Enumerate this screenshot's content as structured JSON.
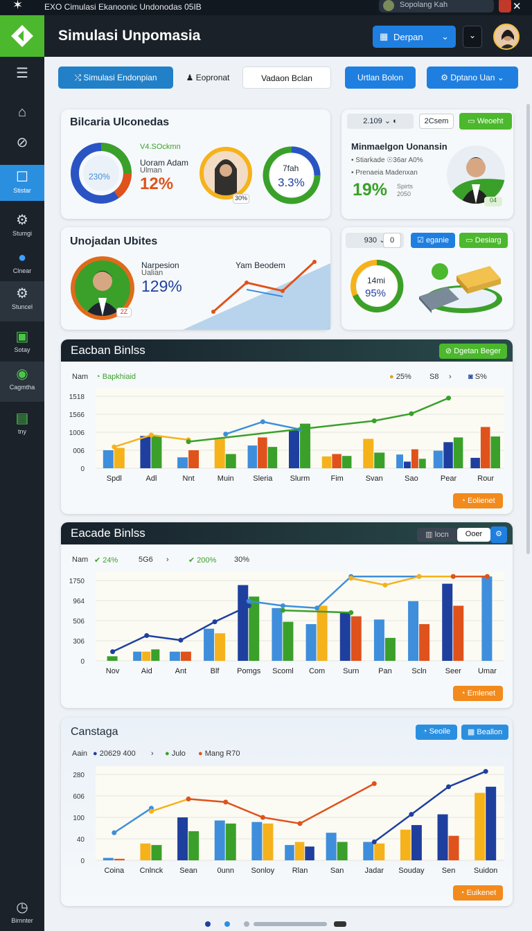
{
  "topbar": {
    "title": "EXO Cimulasi Ekanoonic Undonodas 05IB",
    "search_text": "Sopolang Kah",
    "close_glyph": "✕"
  },
  "header": {
    "title": "Simulasi Unpomasia",
    "dropdown_label": "Derpan"
  },
  "sidebar": {
    "items": [
      {
        "label": ""
      },
      {
        "label": ""
      },
      {
        "label": ""
      },
      {
        "label": "Stistar"
      },
      {
        "label": "Stumgi"
      },
      {
        "label": "Clnear"
      },
      {
        "label": "Stuncel"
      },
      {
        "label": "Sotay"
      },
      {
        "label": "Cagmtha"
      },
      {
        "label": "tny"
      },
      {
        "label": "Birnnter"
      }
    ]
  },
  "tabs": {
    "t1": "Simulasi Endonpian",
    "t2": "Eopronat",
    "t3": "Vadaon Bclan",
    "t4": "Urtlan Bolon",
    "t5": "Dptano Uan"
  },
  "card1": {
    "title": "Bilcaria Ulconedas",
    "ring_pct": "230%",
    "tag": "V4.SOckmn",
    "sub1": "Uoram Adam",
    "sub2": "Ulman",
    "big": "12%",
    "badge": "30%",
    "ring3_top": "7fah",
    "ring3_val": "3.3%"
  },
  "card2": {
    "title": "Minmaelgon Uonansin",
    "sel1": "2.109",
    "sel2": "2Csem",
    "btn": "Weoeht",
    "line1": "• Stiarkade ☉36ar A0%",
    "line2": "• Prenaeia Madenxan",
    "big": "19%",
    "small1": "Spirts",
    "small2": "2050",
    "badge": "04"
  },
  "card3": {
    "title": "Unojadan Ubites",
    "sub1": "Narpesion",
    "sub2": "Ualian",
    "big": "129%",
    "right_label": "Yam Beodem",
    "badge": "2Z"
  },
  "card4": {
    "sel1": "930",
    "sel2": "0",
    "btn1": "eganie",
    "btn2": "Desiarg",
    "ring_top": "14mi",
    "ring_val": "95%"
  },
  "sec1": {
    "title": "Eacban Binlss",
    "head_btn": "Dgetan Beger",
    "leg_name": "Nam",
    "leg1": "Bapkhiaid",
    "leg2": "25%",
    "leg3": "S8",
    "leg4": "S%",
    "btn": "Eolienet"
  },
  "sec2": {
    "title": "Eacade Binlss",
    "seg1": "locn",
    "seg2": "Ooer",
    "leg_name": "Nam",
    "leg1": "24%",
    "leg2": "5G6",
    "leg3": "200%",
    "leg4": "30%",
    "btn": "Emlenet"
  },
  "sec3": {
    "title": "Canstaga",
    "btn1": "Seoile",
    "btn2": "Beallon",
    "leg_name": "Aain",
    "leg1": "20629 400",
    "leg2": "Julo",
    "leg3": "Mang R70",
    "btn": "Euikenet"
  },
  "chart_data": [
    {
      "type": "bar",
      "title": "Eacban Binlss",
      "categories": [
        "Spdl",
        "Adl",
        "Nnt",
        "Muin",
        "Sleria",
        "Slurm",
        "Fim",
        "Svan",
        "Sao",
        "Pear",
        "Rour"
      ],
      "yticks": [
        "0",
        "006",
        "1006",
        "1566",
        "1518"
      ],
      "ylim": [
        0,
        1518
      ],
      "series": [
        {
          "color": "#3e8edc",
          "values": [
            380,
            0,
            230,
            0,
            480,
            0,
            0,
            0,
            290,
            370,
            0
          ]
        },
        {
          "color": "#f5b21b",
          "values": [
            430,
            0,
            0,
            630,
            0,
            0,
            250,
            620,
            0,
            0,
            0
          ]
        },
        {
          "color": "#1f3f9f",
          "values": [
            0,
            680,
            0,
            0,
            0,
            800,
            0,
            0,
            140,
            550,
            220
          ]
        },
        {
          "color": "#e0521b",
          "values": [
            0,
            0,
            380,
            0,
            650,
            0,
            300,
            0,
            400,
            0,
            870
          ]
        },
        {
          "color": "#3aa02a",
          "values": [
            0,
            690,
            0,
            300,
            450,
            940,
            260,
            330,
            200,
            650,
            670
          ]
        }
      ],
      "lines": [
        {
          "color": "#f5b21b",
          "values": [
            450,
            700,
            600,
            0,
            0,
            0,
            0,
            0,
            0,
            0,
            0
          ]
        },
        {
          "color": "#3e8edc",
          "values": [
            0,
            0,
            0,
            720,
            980,
            820,
            0,
            0,
            0,
            0,
            0
          ]
        },
        {
          "color": "#3aa02a",
          "values": [
            0,
            0,
            560,
            0,
            0,
            0,
            0,
            1000,
            1150,
            1480,
            0
          ]
        }
      ]
    },
    {
      "type": "bar",
      "title": "Eacade Binlss",
      "categories": [
        "Nov",
        "Aid",
        "Ant",
        "Blf",
        "Pomgs",
        "Scoml",
        "Com",
        "Surn",
        "Pan",
        "Scln",
        "Seer",
        "Umar"
      ],
      "yticks": [
        "0",
        "306",
        "506",
        "964",
        "1750"
      ],
      "ylim": [
        0,
        1750
      ],
      "series": [
        {
          "color": "#3e8edc",
          "values": [
            0,
            200,
            200,
            700,
            0,
            1150,
            800,
            0,
            900,
            1300,
            0,
            1850
          ]
        },
        {
          "color": "#f5b21b",
          "values": [
            0,
            200,
            0,
            600,
            0,
            0,
            1200,
            0,
            0,
            0,
            0,
            0
          ]
        },
        {
          "color": "#1f3f9f",
          "values": [
            0,
            0,
            0,
            0,
            1650,
            0,
            0,
            1050,
            0,
            0,
            1680,
            0
          ]
        },
        {
          "color": "#e0521b",
          "values": [
            0,
            0,
            200,
            0,
            0,
            0,
            0,
            970,
            0,
            800,
            1200,
            0
          ]
        },
        {
          "color": "#3aa02a",
          "values": [
            100,
            250,
            0,
            0,
            1400,
            850,
            0,
            0,
            500,
            0,
            0,
            0
          ]
        }
      ],
      "lines": [
        {
          "color": "#1f3f9f",
          "values": [
            200,
            550,
            450,
            850,
            1200,
            0,
            0,
            0,
            0,
            0,
            0,
            0
          ]
        },
        {
          "color": "#3aa02a",
          "values": [
            0,
            0,
            0,
            0,
            0,
            1100,
            0,
            1050,
            0,
            0,
            0,
            0
          ]
        },
        {
          "color": "#3e8edc",
          "values": [
            0,
            0,
            0,
            0,
            1300,
            1200,
            1150,
            1900,
            0,
            2000,
            1850,
            0
          ]
        },
        {
          "color": "#f5b21b",
          "values": [
            0,
            0,
            0,
            0,
            0,
            0,
            0,
            1800,
            1650,
            2000,
            0,
            2250
          ]
        },
        {
          "color": "#e0521b",
          "values": [
            0,
            0,
            0,
            0,
            0,
            0,
            0,
            0,
            0,
            0,
            2000,
            2200
          ]
        }
      ]
    },
    {
      "type": "bar",
      "title": "Canstaga",
      "categories": [
        "Coina",
        "Cnlnck",
        "Sean",
        "0unn",
        "Sonloy",
        "Rlan",
        "San",
        "Jadar",
        "Souday",
        "Sen",
        "Suidon"
      ],
      "yticks": [
        "0",
        "40",
        "100",
        "606",
        "280"
      ],
      "ylim": [
        0,
        280
      ],
      "series": [
        {
          "color": "#3e8edc",
          "values": [
            8,
            0,
            0,
            130,
            125,
            50,
            90,
            60,
            0,
            0,
            0
          ]
        },
        {
          "color": "#f5b21b",
          "values": [
            0,
            55,
            0,
            0,
            120,
            60,
            0,
            55,
            100,
            0,
            220
          ]
        },
        {
          "color": "#1f3f9f",
          "values": [
            0,
            0,
            140,
            0,
            0,
            45,
            0,
            0,
            115,
            150,
            240
          ]
        },
        {
          "color": "#e0521b",
          "values": [
            5,
            0,
            0,
            0,
            0,
            0,
            0,
            0,
            0,
            80,
            0
          ]
        },
        {
          "color": "#3aa02a",
          "values": [
            0,
            50,
            95,
            120,
            0,
            0,
            60,
            0,
            0,
            0,
            0
          ]
        }
      ],
      "lines": [
        {
          "color": "#3e8edc",
          "values": [
            90,
            170,
            0,
            0,
            0,
            0,
            0,
            0,
            0,
            0,
            0
          ]
        },
        {
          "color": "#f5b21b",
          "values": [
            0,
            160,
            200,
            0,
            0,
            0,
            0,
            0,
            0,
            0,
            0
          ]
        },
        {
          "color": "#e0521b",
          "values": [
            0,
            0,
            200,
            190,
            140,
            120,
            0,
            250,
            0,
            0,
            0
          ]
        },
        {
          "color": "#1f3f9f",
          "values": [
            0,
            0,
            0,
            0,
            0,
            0,
            0,
            60,
            150,
            240,
            290
          ]
        }
      ]
    }
  ]
}
